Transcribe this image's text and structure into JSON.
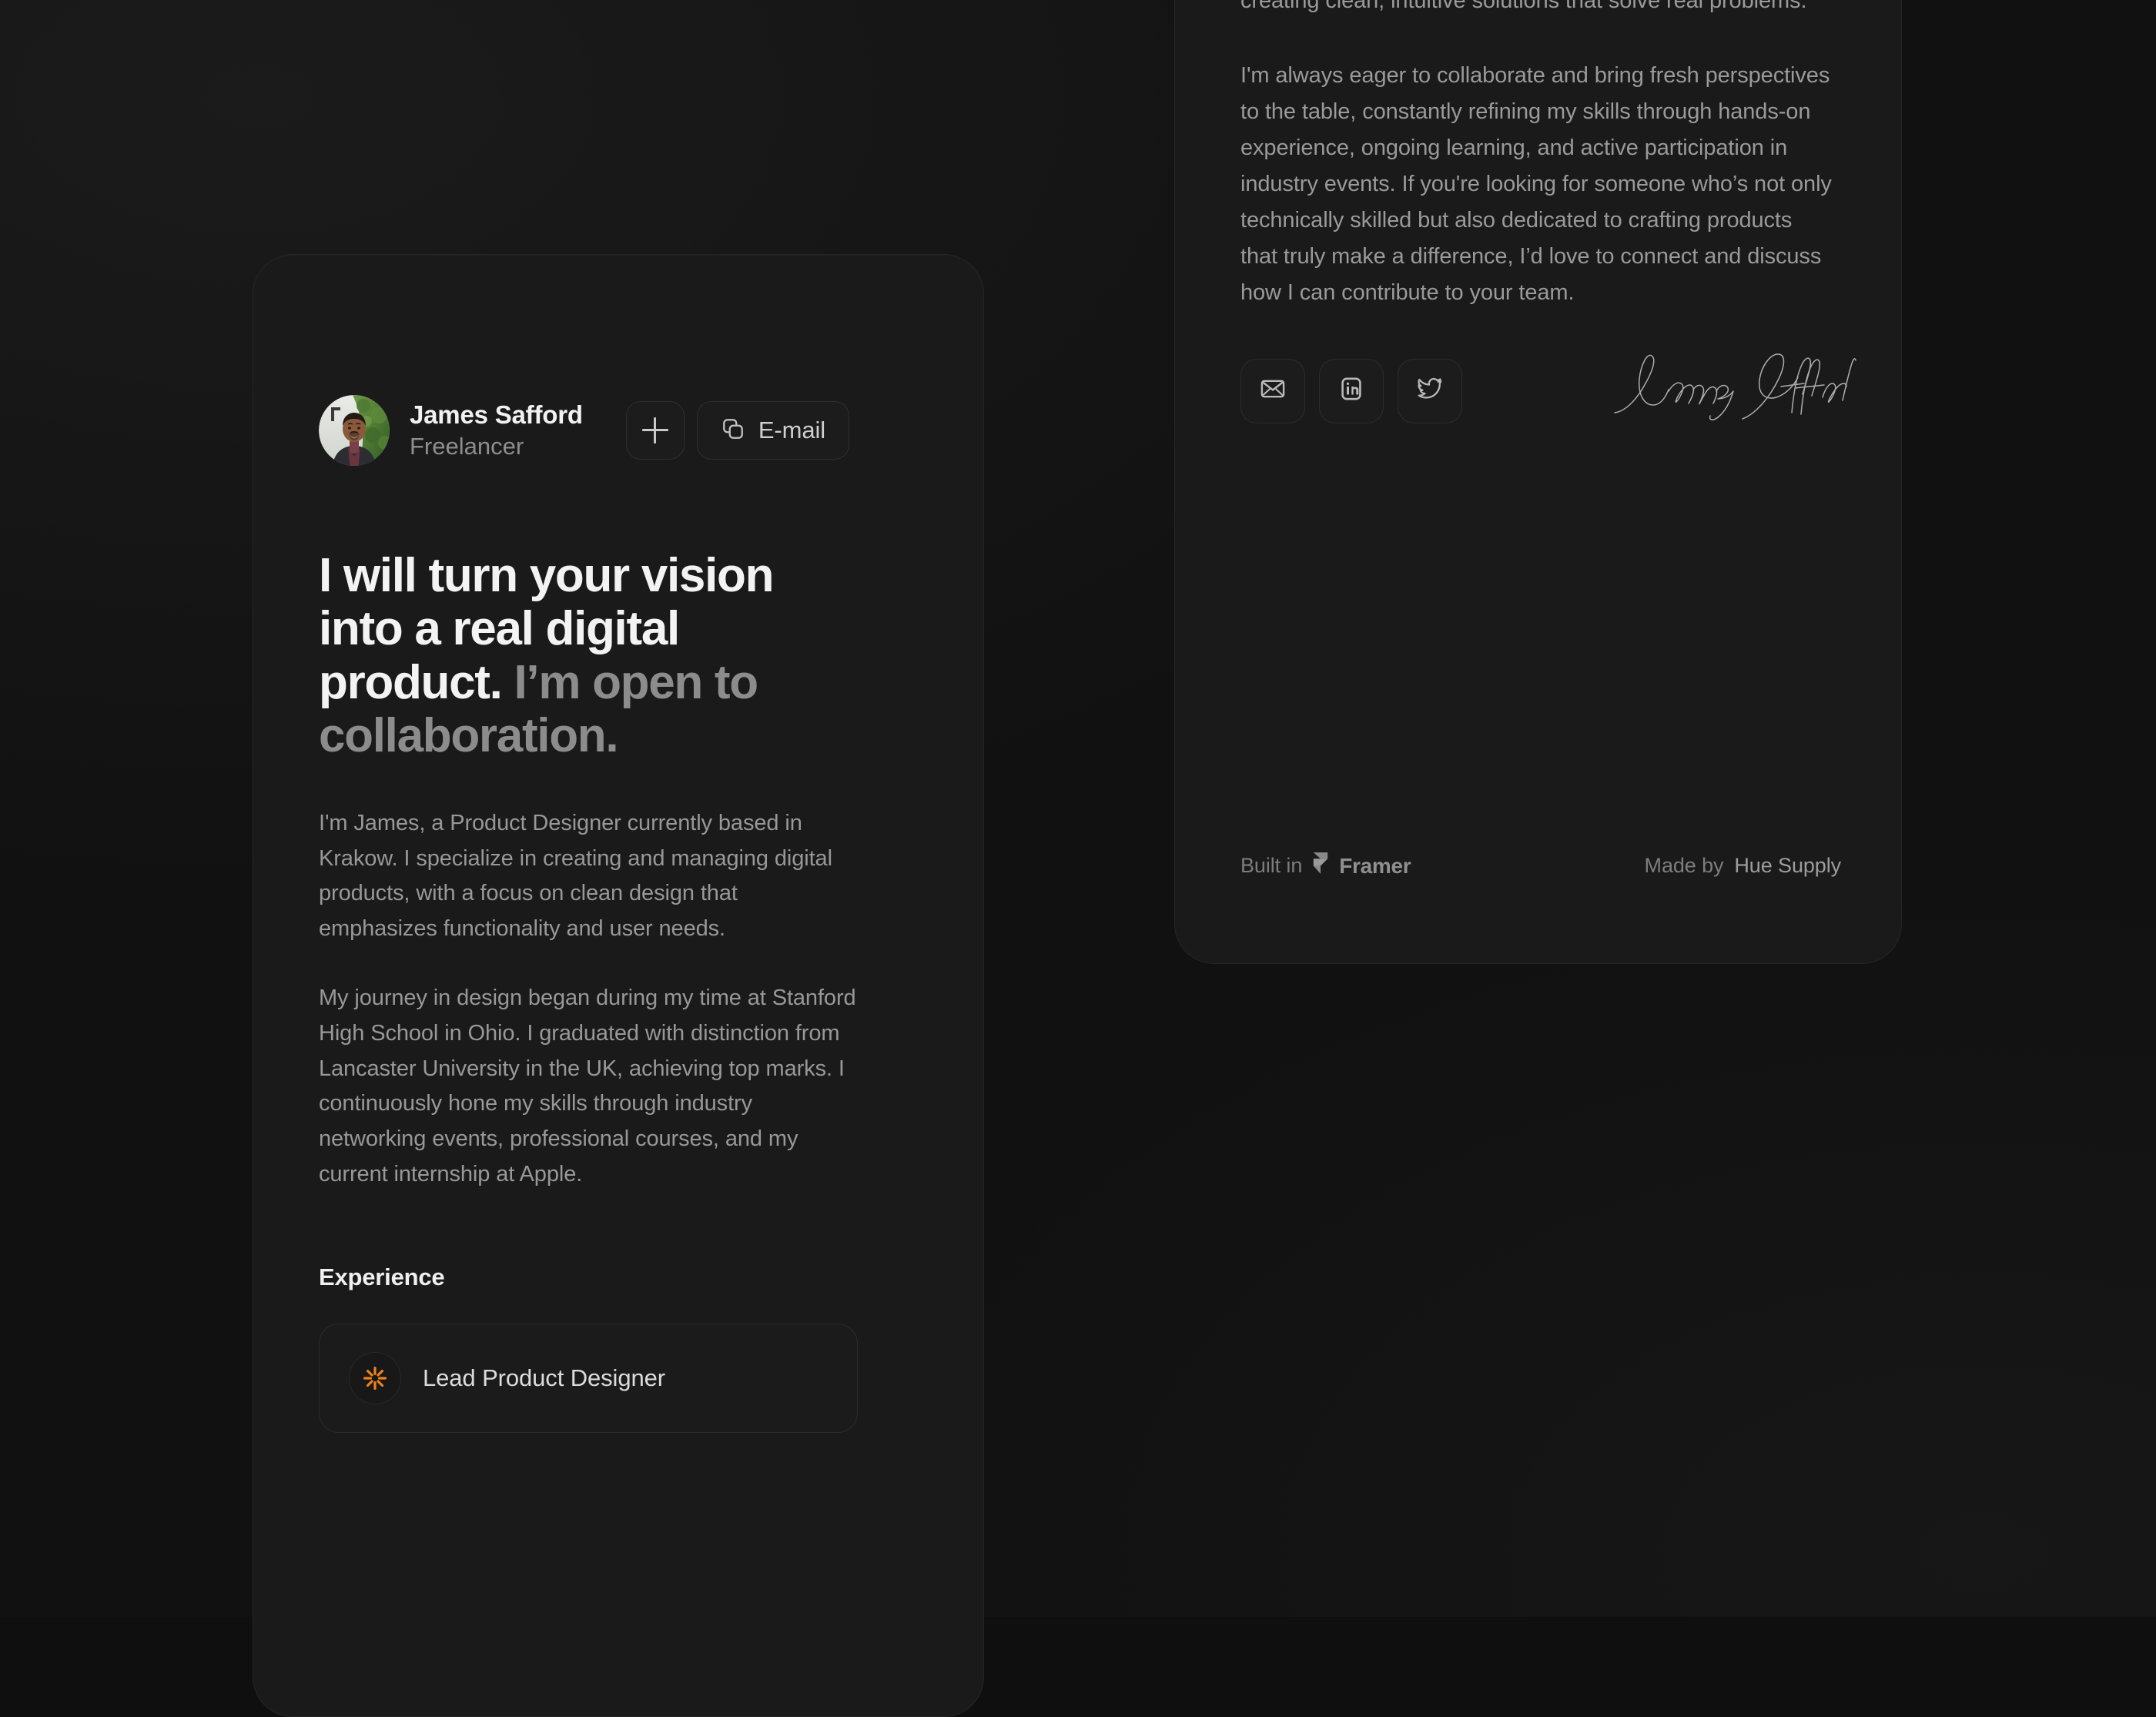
{
  "background": {
    "page_color": "#111111",
    "card_color": "#1a1a1a"
  },
  "left_card": {
    "profile": {
      "name": "James Safford",
      "role": "Freelancer",
      "avatar_alt": "avatar-photo",
      "actions": {
        "add_icon": "plus-icon",
        "copy_icon": "copy-icon",
        "email_label": "E-mail"
      }
    },
    "headline": {
      "strong": "I will turn your vision into a real digital product.",
      "muted": " I’m open to collaboration."
    },
    "paragraphs": [
      "I'm James, a Product Designer currently based in Krakow. I specialize in creating and managing digital products, with a focus on clean design that emphasizes functionality and user needs.",
      "My journey in design began during my time at Stanford High School in Ohio. I graduated with distinction from Lancaster University in the UK, achieving top marks. I continuously hone my skills through industry networking events, professional courses, and my current internship at Apple."
    ],
    "experience": {
      "section_title": "Experience",
      "items": [
        {
          "logo_icon": "sunburst-logo-icon",
          "title": "Lead Product Designer"
        }
      ]
    }
  },
  "right_card": {
    "paragraphs": [
      "creating clean, intuitive solutions that solve real problems.",
      "I'm always eager to collaborate and bring fresh perspectives to the table, constantly refining my skills through hands-on experience, ongoing learning, and active participation in industry events. If you're looking for someone who’s not only technically skilled but also dedicated to crafting products that truly make a difference, I’d love to connect and discuss how I can contribute to your team."
    ],
    "socials": [
      {
        "icon": "email-icon",
        "name": "email"
      },
      {
        "icon": "linkedin-icon",
        "name": "linkedin"
      },
      {
        "icon": "twitter-icon",
        "name": "twitter"
      }
    ],
    "signature": {
      "icon": "signature-mark",
      "text": "James Safford"
    },
    "footer": {
      "built_prefix": "Built in",
      "built_brand": "Framer",
      "built_icon": "framer-logo-icon",
      "made_prefix": "Made by",
      "made_brand": "Hue Supply"
    }
  }
}
